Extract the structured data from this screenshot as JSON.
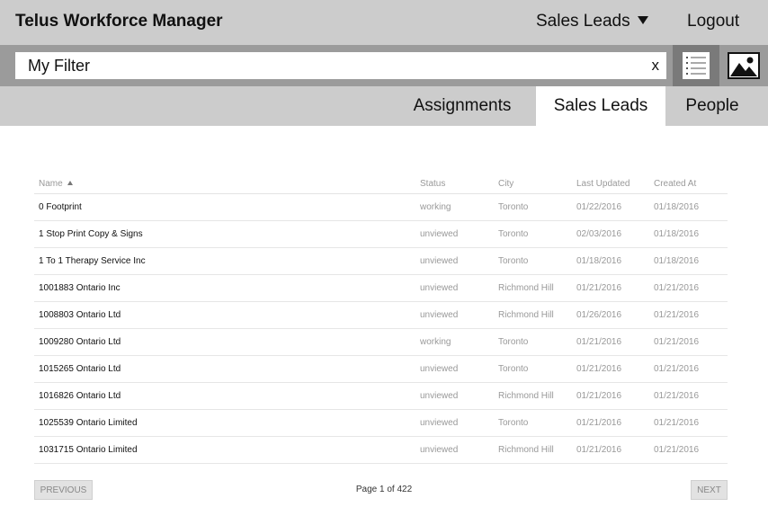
{
  "header": {
    "app_title": "Telus Workforce Manager",
    "menu_label": "Sales Leads",
    "logout_label": "Logout"
  },
  "filter": {
    "value": "My Filter",
    "clear_label": "x"
  },
  "view_toggle": {
    "list_icon": "list-icon",
    "image_icon": "image-icon",
    "active": "list"
  },
  "tabs": [
    {
      "label": "Assignments",
      "active": false
    },
    {
      "label": "Sales Leads",
      "active": true
    },
    {
      "label": "People",
      "active": false
    }
  ],
  "table": {
    "columns": [
      "Name",
      "Status",
      "City",
      "Last Updated",
      "Created At"
    ],
    "sort": {
      "column": "Name",
      "direction": "asc"
    },
    "rows": [
      {
        "name": "0 Footprint",
        "status": "working",
        "city": "Toronto",
        "last_updated": "01/22/2016",
        "created_at": "01/18/2016"
      },
      {
        "name": "1 Stop Print Copy & Signs",
        "status": "unviewed",
        "city": "Toronto",
        "last_updated": "02/03/2016",
        "created_at": "01/18/2016"
      },
      {
        "name": "1 To 1 Therapy Service Inc",
        "status": "unviewed",
        "city": "Toronto",
        "last_updated": "01/18/2016",
        "created_at": "01/18/2016"
      },
      {
        "name": "1001883 Ontario Inc",
        "status": "unviewed",
        "city": "Richmond Hill",
        "last_updated": "01/21/2016",
        "created_at": "01/21/2016"
      },
      {
        "name": "1008803 Ontario Ltd",
        "status": "unviewed",
        "city": "Richmond Hill",
        "last_updated": "01/26/2016",
        "created_at": "01/21/2016"
      },
      {
        "name": "1009280 Ontario Ltd",
        "status": "working",
        "city": "Toronto",
        "last_updated": "01/21/2016",
        "created_at": "01/21/2016"
      },
      {
        "name": "1015265 Ontario Ltd",
        "status": "unviewed",
        "city": "Toronto",
        "last_updated": "01/21/2016",
        "created_at": "01/21/2016"
      },
      {
        "name": "1016826 Ontario Ltd",
        "status": "unviewed",
        "city": "Richmond Hill",
        "last_updated": "01/21/2016",
        "created_at": "01/21/2016"
      },
      {
        "name": "1025539 Ontario Limited",
        "status": "unviewed",
        "city": "Toronto",
        "last_updated": "01/21/2016",
        "created_at": "01/21/2016"
      },
      {
        "name": "1031715 Ontario Limited",
        "status": "unviewed",
        "city": "Richmond Hill",
        "last_updated": "01/21/2016",
        "created_at": "01/21/2016"
      }
    ]
  },
  "pagination": {
    "previous_label": "PREVIOUS",
    "next_label": "NEXT",
    "page_info": "Page 1 of 422"
  }
}
